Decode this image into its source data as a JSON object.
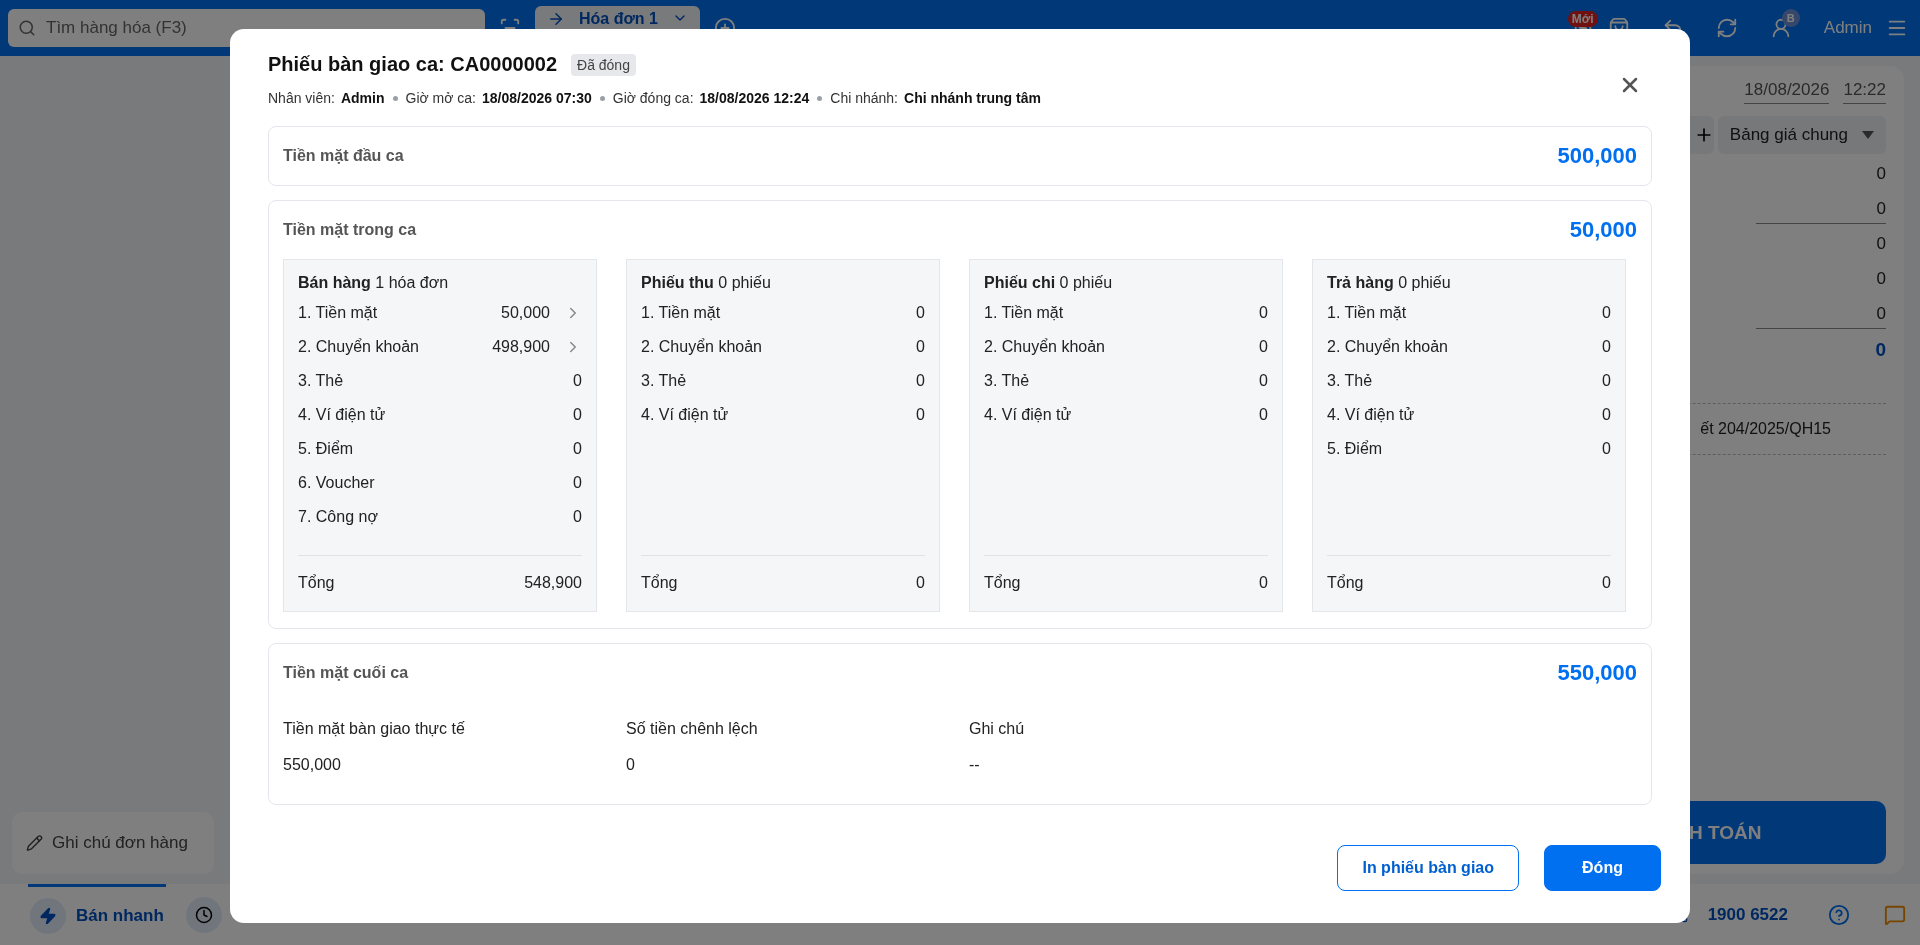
{
  "topbar": {
    "search": {
      "placeholder": "Tìm hàng hóa (F3)"
    },
    "tabs": [
      {
        "label": "Hóa đơn 1",
        "selected": true
      }
    ],
    "new_badge": "Mới",
    "user_badge": "B",
    "user": "Admin"
  },
  "order_panel": {
    "date": "18/08/2026",
    "time": "12:22",
    "price_list": "Bảng giá chung",
    "amounts": [
      "0",
      "0",
      "0",
      "0",
      "0"
    ],
    "total": "0",
    "note": "ết 204/2025/QH15",
    "pay_button": "H TOÁN"
  },
  "order_note": {
    "placeholder": "Ghi chú đơn hàng"
  },
  "bottom_bar": {
    "modes": [
      {
        "label": "Bán nhanh",
        "selected": true
      }
    ],
    "hotline": "1900 6522"
  },
  "dialog": {
    "title": "Phiếu bàn giao ca: CA0000002",
    "status": "Đã đóng",
    "meta": [
      {
        "label": "Nhân viên:",
        "value": "Admin"
      },
      {
        "label": "Giờ mở ca:",
        "value": "18/08/2026 07:30"
      },
      {
        "label": "Giờ đóng ca:",
        "value": "18/08/2026 12:24"
      },
      {
        "label": "Chi nhánh:",
        "value": "Chi nhánh trung tâm"
      }
    ],
    "opening_cash": {
      "label": "Tiền mặt đầu ca",
      "amount": "500,000"
    },
    "shift_cash": {
      "label": "Tiền mặt trong ca",
      "amount": "50,000",
      "groups": [
        {
          "heading": "**Bán hàng** 1 hóa đơn",
          "rows": [
            {
              "label": "1. Tiền mặt",
              "value": "50,000",
              "expandable": true
            },
            {
              "label": "2. Chuyển khoản",
              "value": "498,900",
              "expandable": true
            },
            {
              "label": "3. Thẻ",
              "value": "0",
              "expandable": false
            },
            {
              "label": "4. Ví điện tử",
              "value": "0",
              "expandable": false
            },
            {
              "label": "5. Điểm",
              "value": "0",
              "expandable": false
            },
            {
              "label": "6. Voucher",
              "value": "0",
              "expandable": false
            },
            {
              "label": "7. Công nợ",
              "value": "0",
              "expandable": false
            }
          ],
          "total_label": "Tổng",
          "total": "548,900"
        },
        {
          "heading": "**Phiếu thu** 0 phiếu",
          "rows": [
            {
              "label": "1. Tiền mặt",
              "value": "0",
              "expandable": false
            },
            {
              "label": "2. Chuyển khoản",
              "value": "0",
              "expandable": false
            },
            {
              "label": "3. Thẻ",
              "value": "0",
              "expandable": false
            },
            {
              "label": "4. Ví điện tử",
              "value": "0",
              "expandable": false
            }
          ],
          "total_label": "Tổng",
          "total": "0"
        },
        {
          "heading": "**Phiếu chi** 0 phiếu",
          "rows": [
            {
              "label": "1. Tiền mặt",
              "value": "0",
              "expandable": false
            },
            {
              "label": "2. Chuyển khoản",
              "value": "0",
              "expandable": false
            },
            {
              "label": "3. Thẻ",
              "value": "0",
              "expandable": false
            },
            {
              "label": "4. Ví điện tử",
              "value": "0",
              "expandable": false
            }
          ],
          "total_label": "Tổng",
          "total": "0"
        },
        {
          "heading": "**Trả hàng** 0 phiếu",
          "rows": [
            {
              "label": "1. Tiền mặt",
              "value": "0",
              "expandable": false
            },
            {
              "label": "2. Chuyển khoản",
              "value": "0",
              "expandable": false
            },
            {
              "label": "3. Thẻ",
              "value": "0",
              "expandable": false
            },
            {
              "label": "4. Ví điện tử",
              "value": "0",
              "expandable": false
            },
            {
              "label": "5. Điểm",
              "value": "0",
              "expandable": false
            }
          ],
          "total_label": "Tổng",
          "total": "0"
        }
      ]
    },
    "closing_cash": {
      "label": "Tiền mặt cuối ca",
      "amount": "550,000",
      "fields": [
        {
          "label": "Tiền mặt bàn giao thực tế",
          "value": "550,000"
        },
        {
          "label": "Số tiền chênh lệch",
          "value": "0"
        },
        {
          "label": "Ghi chú",
          "value": "--"
        }
      ]
    },
    "buttons": [
      {
        "label": "In phiếu bàn giao",
        "kind": "outline"
      },
      {
        "label": "Đóng",
        "kind": "primary"
      }
    ]
  }
}
